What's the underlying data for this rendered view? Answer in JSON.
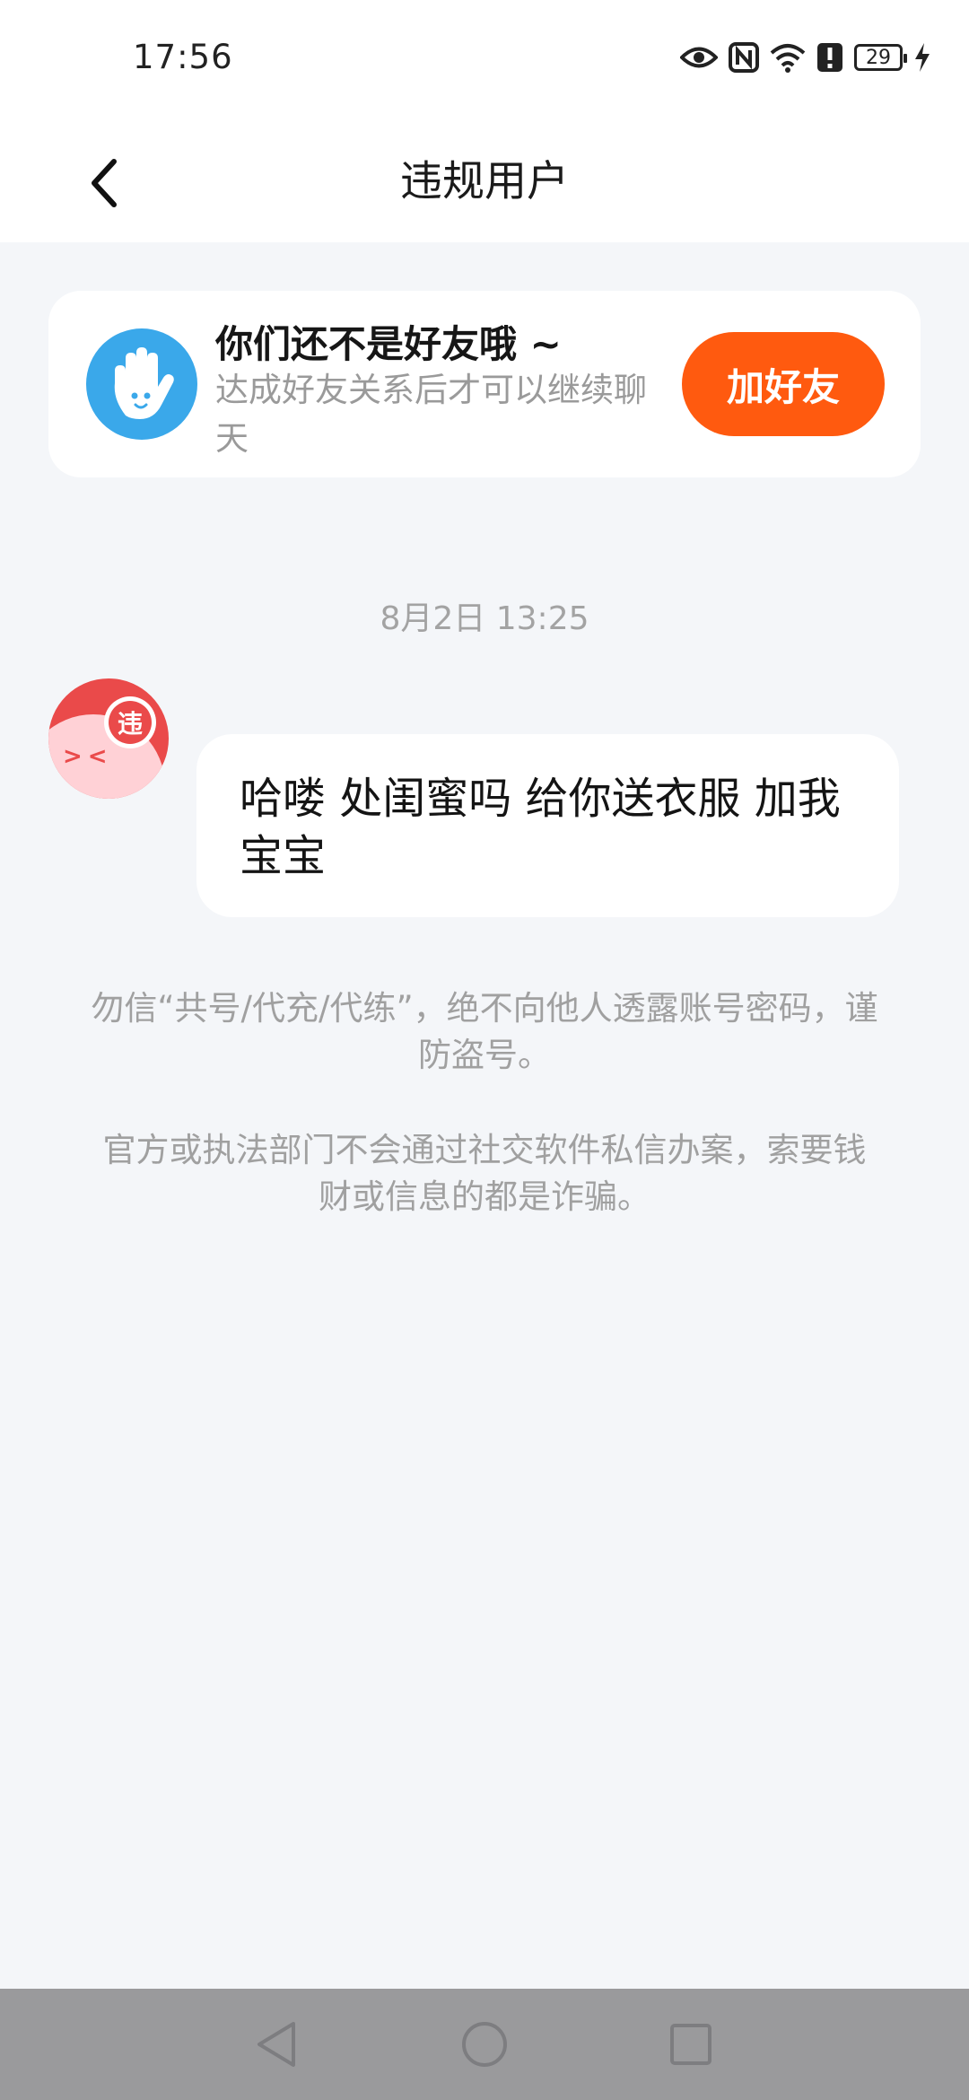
{
  "status_bar": {
    "time": "17:56",
    "battery_level": "29",
    "icons": [
      "eye-icon",
      "nfc-icon",
      "wifi-icon",
      "alert-icon",
      "battery-icon",
      "charging-icon"
    ]
  },
  "header": {
    "title": "违规用户",
    "back_icon": "chevron-left-icon"
  },
  "friend_card": {
    "avatar_icon": "waving-hand-icon",
    "title": "你们还不是好友哦 ~",
    "description": "达成好友关系后才可以继续聊天",
    "button_label": "加好友"
  },
  "chat": {
    "timestamp": "8月2日 13:25",
    "sender_badge": "违",
    "message": "哈喽 处闺蜜吗 给你送衣服 加我宝宝"
  },
  "notices": [
    "勿信“共号/代充/代练”，绝不向他人透露账号密码，谨防盗号。",
    "官方或执法部门不会通过社交软件私信办案，索要钱财或信息的都是诈骗。"
  ],
  "colors": {
    "accent": "#ff5a0f",
    "avatar_blue": "#3aa8ea",
    "violation_red": "#ea4a4a",
    "background": "#f4f6f9"
  },
  "nav_bar": {
    "icons": [
      "back-triangle-icon",
      "home-circle-icon",
      "recents-square-icon"
    ]
  }
}
